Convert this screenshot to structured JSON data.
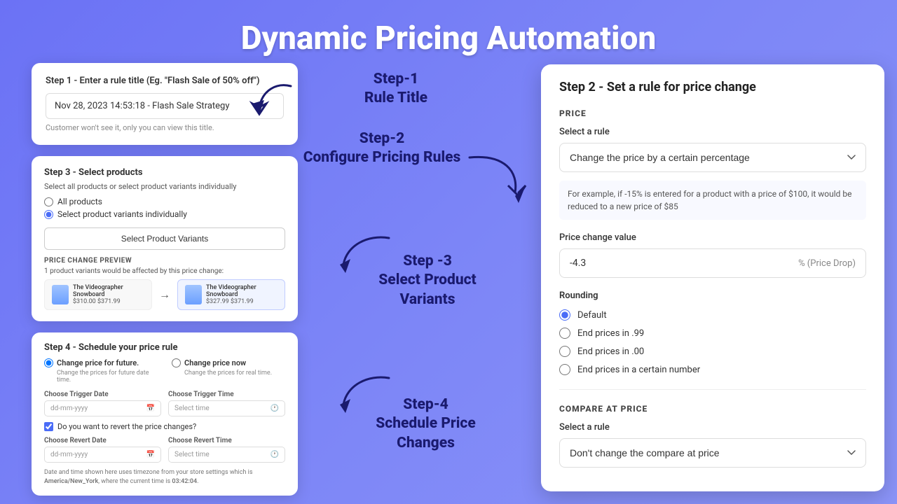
{
  "page": {
    "title": "Dynamic Pricing Automation"
  },
  "step1": {
    "heading": "Step 1 - Enter a rule title (Eg. \"Flash Sale of 50% off\")",
    "input_value": "Nov 28, 2023 14:53:18 - Flash Sale Strategy",
    "hint": "Customer won't see it, only you can view this title."
  },
  "step2_label": {
    "line1": "Step-1",
    "line2": "Rule Title"
  },
  "step2_configure_label": {
    "line1": "Step-2",
    "line2": "Configure Pricing Rules"
  },
  "step3_label": {
    "line1": "Step -3",
    "line2": "Select Product",
    "line3": "Variants"
  },
  "step4_label": {
    "line1": "Step-4",
    "line2": "Schedule Price",
    "line3": "Changes"
  },
  "step3": {
    "heading": "Step 3 - Select products",
    "sub": "Select all products or select product variants individually",
    "radio1": "All products",
    "radio2": "Select product variants individually",
    "btn": "Select Product Variants",
    "preview_label": "PRICE CHANGE PREVIEW",
    "affected": "1 product variants would be affected by this price change:",
    "product1_name": "The Videographer Snowboard",
    "product1_price": "$310.00  $371.99",
    "product2_name": "The Videographer Snowboard",
    "product2_price": "$327.99  $371.99"
  },
  "step4": {
    "heading": "Step 4 - Schedule your price rule",
    "option1_label": "Change price for future.",
    "option1_desc": "Change the prices for future date time.",
    "option2_label": "Change price now",
    "option2_desc": "Change the prices for real time.",
    "trigger_date_label": "Choose Trigger Date",
    "trigger_time_label": "Choose Trigger Time",
    "trigger_date_placeholder": "dd-mm-yyyy",
    "trigger_time_placeholder": "Select time",
    "revert_checkbox": "Do you want to revert the price changes?",
    "revert_date_label": "Choose Revert Date",
    "revert_time_label": "Choose Revert Time",
    "revert_date_placeholder": "dd-mm-yyyy",
    "revert_time_placeholder": "Select time",
    "footer": "Date and time shown here uses timezone from your store settings which is America/New_York, where the current time is 03:42:04."
  },
  "right_panel": {
    "heading": "Step 2 - Set a rule for price change",
    "price_section_label": "PRICE",
    "select_rule_label": "Select a rule",
    "select_rule_value": "Change the price by a certain percentage",
    "info_text": "For example, if -15% is entered for a product with a price of $100, it would be reduced to a new price of $85",
    "price_change_label": "Price change value",
    "price_change_value": "-4.3",
    "price_change_suffix": "% (Price Drop)",
    "rounding_label": "Rounding",
    "rounding_options": [
      {
        "label": "Default",
        "checked": true
      },
      {
        "label": "End prices in .99",
        "checked": false
      },
      {
        "label": "End prices in .00",
        "checked": false
      },
      {
        "label": "End prices in a certain number",
        "checked": false
      }
    ],
    "compare_section_label": "COMPARE AT PRICE",
    "compare_rule_label": "Select a rule",
    "compare_rule_value": "Don't change the compare at price"
  }
}
